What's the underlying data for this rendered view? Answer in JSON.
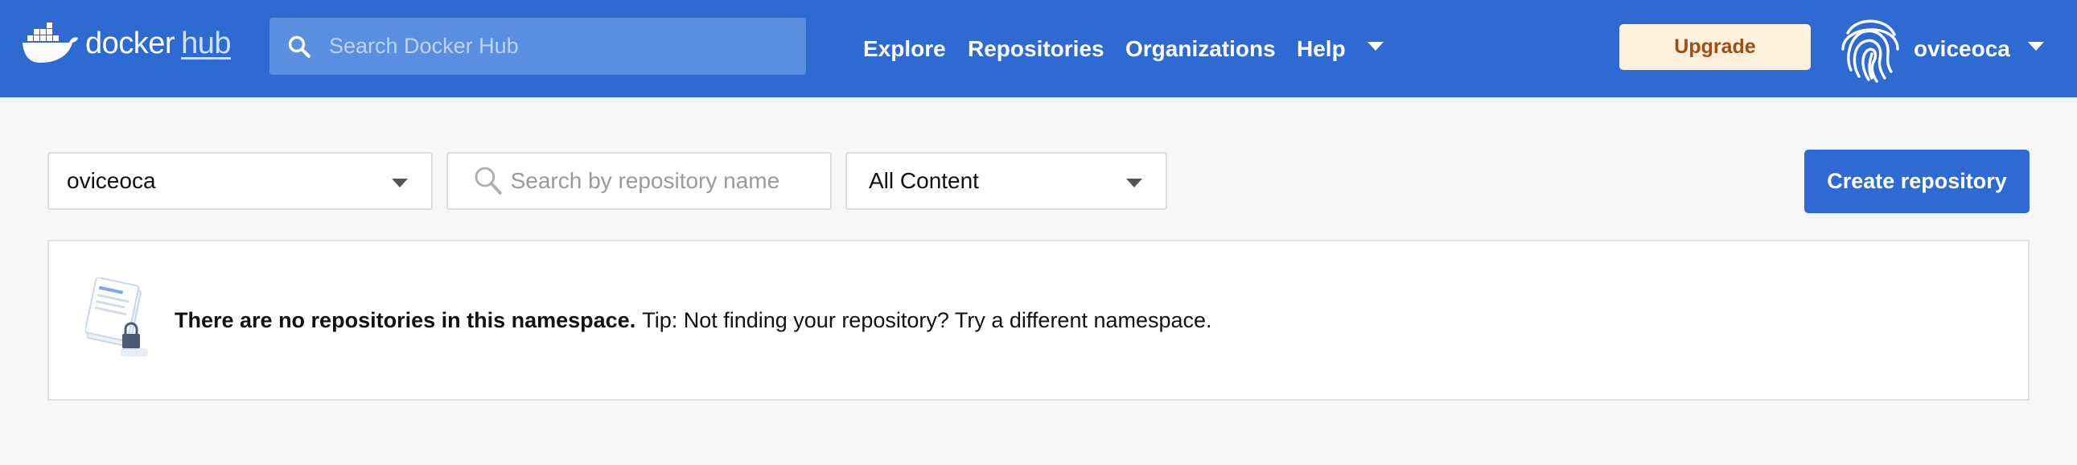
{
  "header": {
    "logo": {
      "docker": "docker",
      "hub": "hub"
    },
    "search_placeholder": "Search Docker Hub",
    "nav": {
      "explore": "Explore",
      "repositories": "Repositories",
      "organizations": "Organizations",
      "help": "Help"
    },
    "upgrade_label": "Upgrade",
    "username": "oviceoca",
    "icons": [
      "docker-whale-icon",
      "search-icon",
      "chevron-down-icon",
      "fingerprint-icon"
    ]
  },
  "filters": {
    "namespace_value": "oviceoca",
    "repo_search_placeholder": "Search by repository name",
    "content_filter_value": "All Content"
  },
  "actions": {
    "create_repository_label": "Create repository"
  },
  "empty_state": {
    "title": "There are no repositories in this namespace.",
    "tip": "Tip: Not finding your repository? Try a different namespace."
  },
  "colors": {
    "header_bg": "#2e6ad1",
    "primary_button": "#2e6ad1",
    "upgrade_bg": "#fdf1dd",
    "upgrade_text": "#a14c12",
    "page_bg": "#f7f7f7"
  }
}
